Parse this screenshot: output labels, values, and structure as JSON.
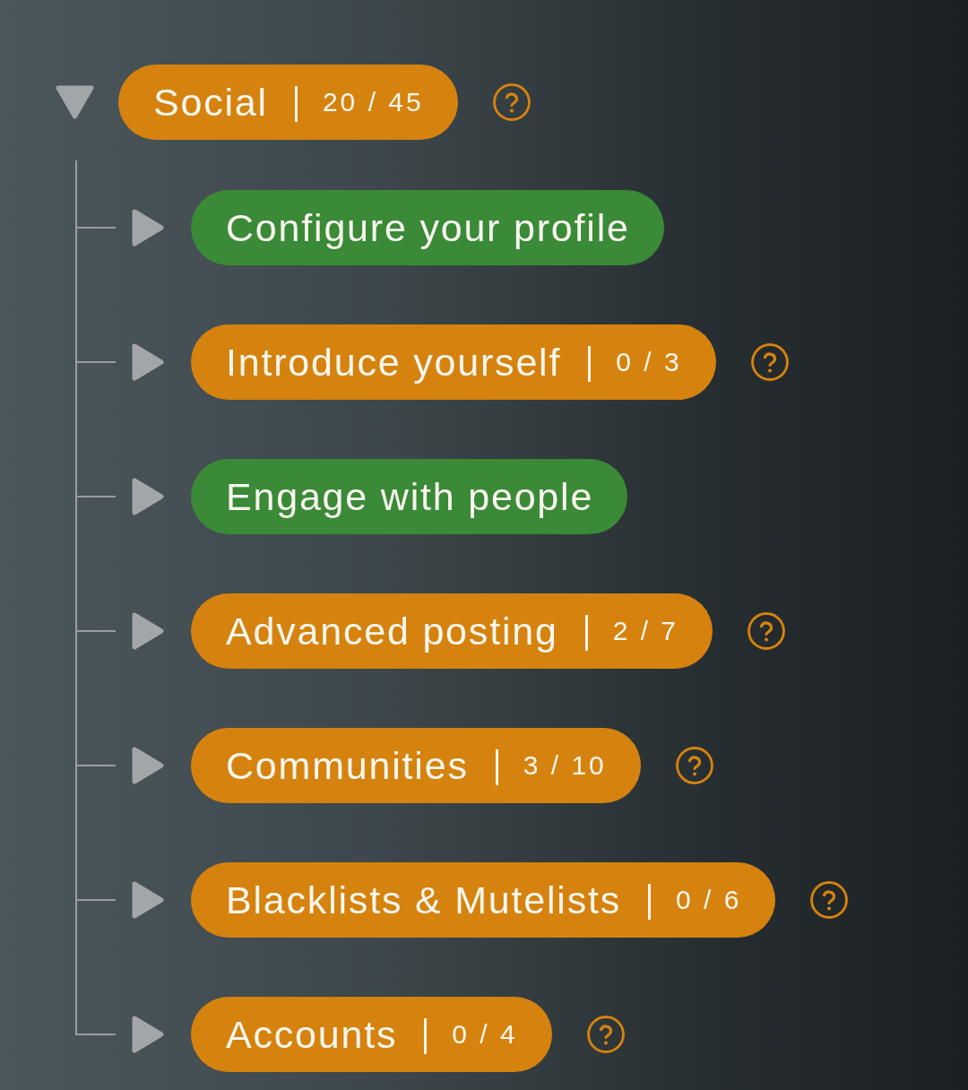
{
  "tree": {
    "label": "Social",
    "count": "20 / 45",
    "expanded": true,
    "completed": false,
    "help": true,
    "children": [
      {
        "label": "Configure your profile",
        "expanded": false,
        "completed": true,
        "help": false
      },
      {
        "label": "Introduce yourself",
        "count": "0 / 3",
        "expanded": false,
        "completed": false,
        "help": true
      },
      {
        "label": "Engage with people",
        "expanded": false,
        "completed": true,
        "help": false
      },
      {
        "label": "Advanced posting",
        "count": "2 / 7",
        "expanded": false,
        "completed": false,
        "help": true
      },
      {
        "label": "Communities",
        "count": "3 / 10",
        "expanded": false,
        "completed": false,
        "help": true
      },
      {
        "label": "Blacklists & Mutelists",
        "count": "0 / 6",
        "expanded": false,
        "completed": false,
        "help": true
      },
      {
        "label": "Accounts",
        "count": "0 / 4",
        "expanded": false,
        "completed": false,
        "help": true
      }
    ]
  }
}
